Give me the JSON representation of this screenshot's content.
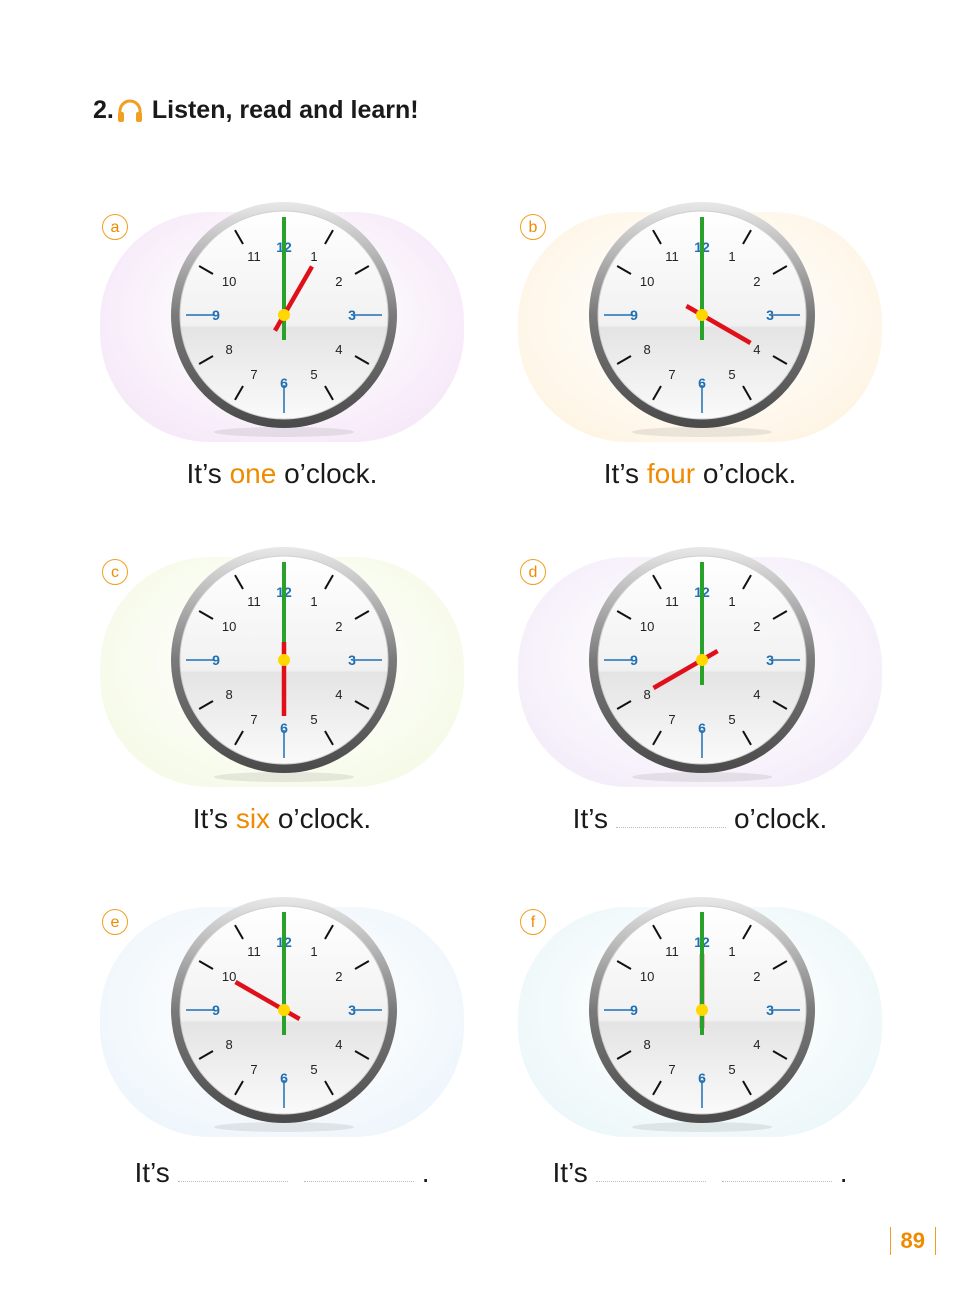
{
  "heading": {
    "number": "2.",
    "title": "Listen, read and learn!",
    "icon": "headphones-icon"
  },
  "items": [
    {
      "letter": "a",
      "hour": 1,
      "before": "It’s ",
      "highlight": "one",
      "after": " o’clock.",
      "answered": true,
      "bg": "#e9c8ef"
    },
    {
      "letter": "b",
      "hour": 4,
      "before": "It’s ",
      "highlight": "four",
      "after": " o’clock.",
      "answered": true,
      "bg": "#fbe5bd"
    },
    {
      "letter": "c",
      "hour": 6,
      "before": "It’s ",
      "highlight": "six",
      "after": " o’clock.",
      "answered": true,
      "bg": "#e8f3c4"
    },
    {
      "letter": "d",
      "hour": 8,
      "before": "It’s",
      "highlight": "",
      "after": "o’clock.",
      "answered": false,
      "bg": "#e4d3f1"
    },
    {
      "letter": "e",
      "hour": 10,
      "before": "It’s",
      "highlight": "",
      "after": ".",
      "answered": false,
      "bg": "#d6e8f7"
    },
    {
      "letter": "f",
      "hour": 12,
      "before": "It’s",
      "highlight": "",
      "after": ".",
      "answered": false,
      "bg": "#d2ecf1"
    }
  ],
  "clock_numbers": [
    "12",
    "1",
    "2",
    "3",
    "4",
    "5",
    "6",
    "7",
    "8",
    "9",
    "10",
    "11"
  ],
  "colors": {
    "accent": "#f08a00",
    "hand_hour": "#e0101a",
    "hand_minute": "#2aa12a",
    "pin": "#ffd800",
    "quarter_numbers": "#1e6fb3"
  },
  "page_number": "89"
}
